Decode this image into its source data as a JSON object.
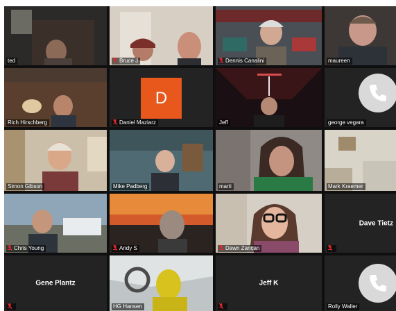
{
  "meeting": {
    "participants": [
      {
        "name": "ted",
        "muted": false
      },
      {
        "name": "Bruce J",
        "muted": true
      },
      {
        "name": "Dennis Canalini",
        "muted": true
      },
      {
        "name": "maureen",
        "muted": false
      },
      {
        "name": "Rich Hirschberg",
        "muted": false
      },
      {
        "name": "Daniel Maziarz",
        "muted": true,
        "avatar_letter": "D"
      },
      {
        "name": "Jeff",
        "muted": false
      },
      {
        "name": "george vegara",
        "muted": false
      },
      {
        "name": "Simon Gibson",
        "muted": false
      },
      {
        "name": "Mike Padberg",
        "muted": false
      },
      {
        "name": "marti",
        "muted": false
      },
      {
        "name": "Mark Kraemer",
        "muted": false
      },
      {
        "name": "Chris Young",
        "muted": true
      },
      {
        "name": "Andy S",
        "muted": true
      },
      {
        "name": "Dawn Zancan",
        "muted": true
      },
      {
        "name": "Dave Tietz",
        "muted": true
      },
      {
        "name": "Gene Plantz",
        "muted": true
      },
      {
        "name": "HG Hansen",
        "muted": false
      },
      {
        "name": "Jeff K",
        "muted": true
      },
      {
        "name": "Rolly Waller",
        "muted": false
      }
    ]
  },
  "colors": {
    "active_speaker_border": "#c6d92a",
    "mute_icon": "#e02828",
    "avatar_bg": "#e8571b",
    "tile_bg": "#232323"
  }
}
